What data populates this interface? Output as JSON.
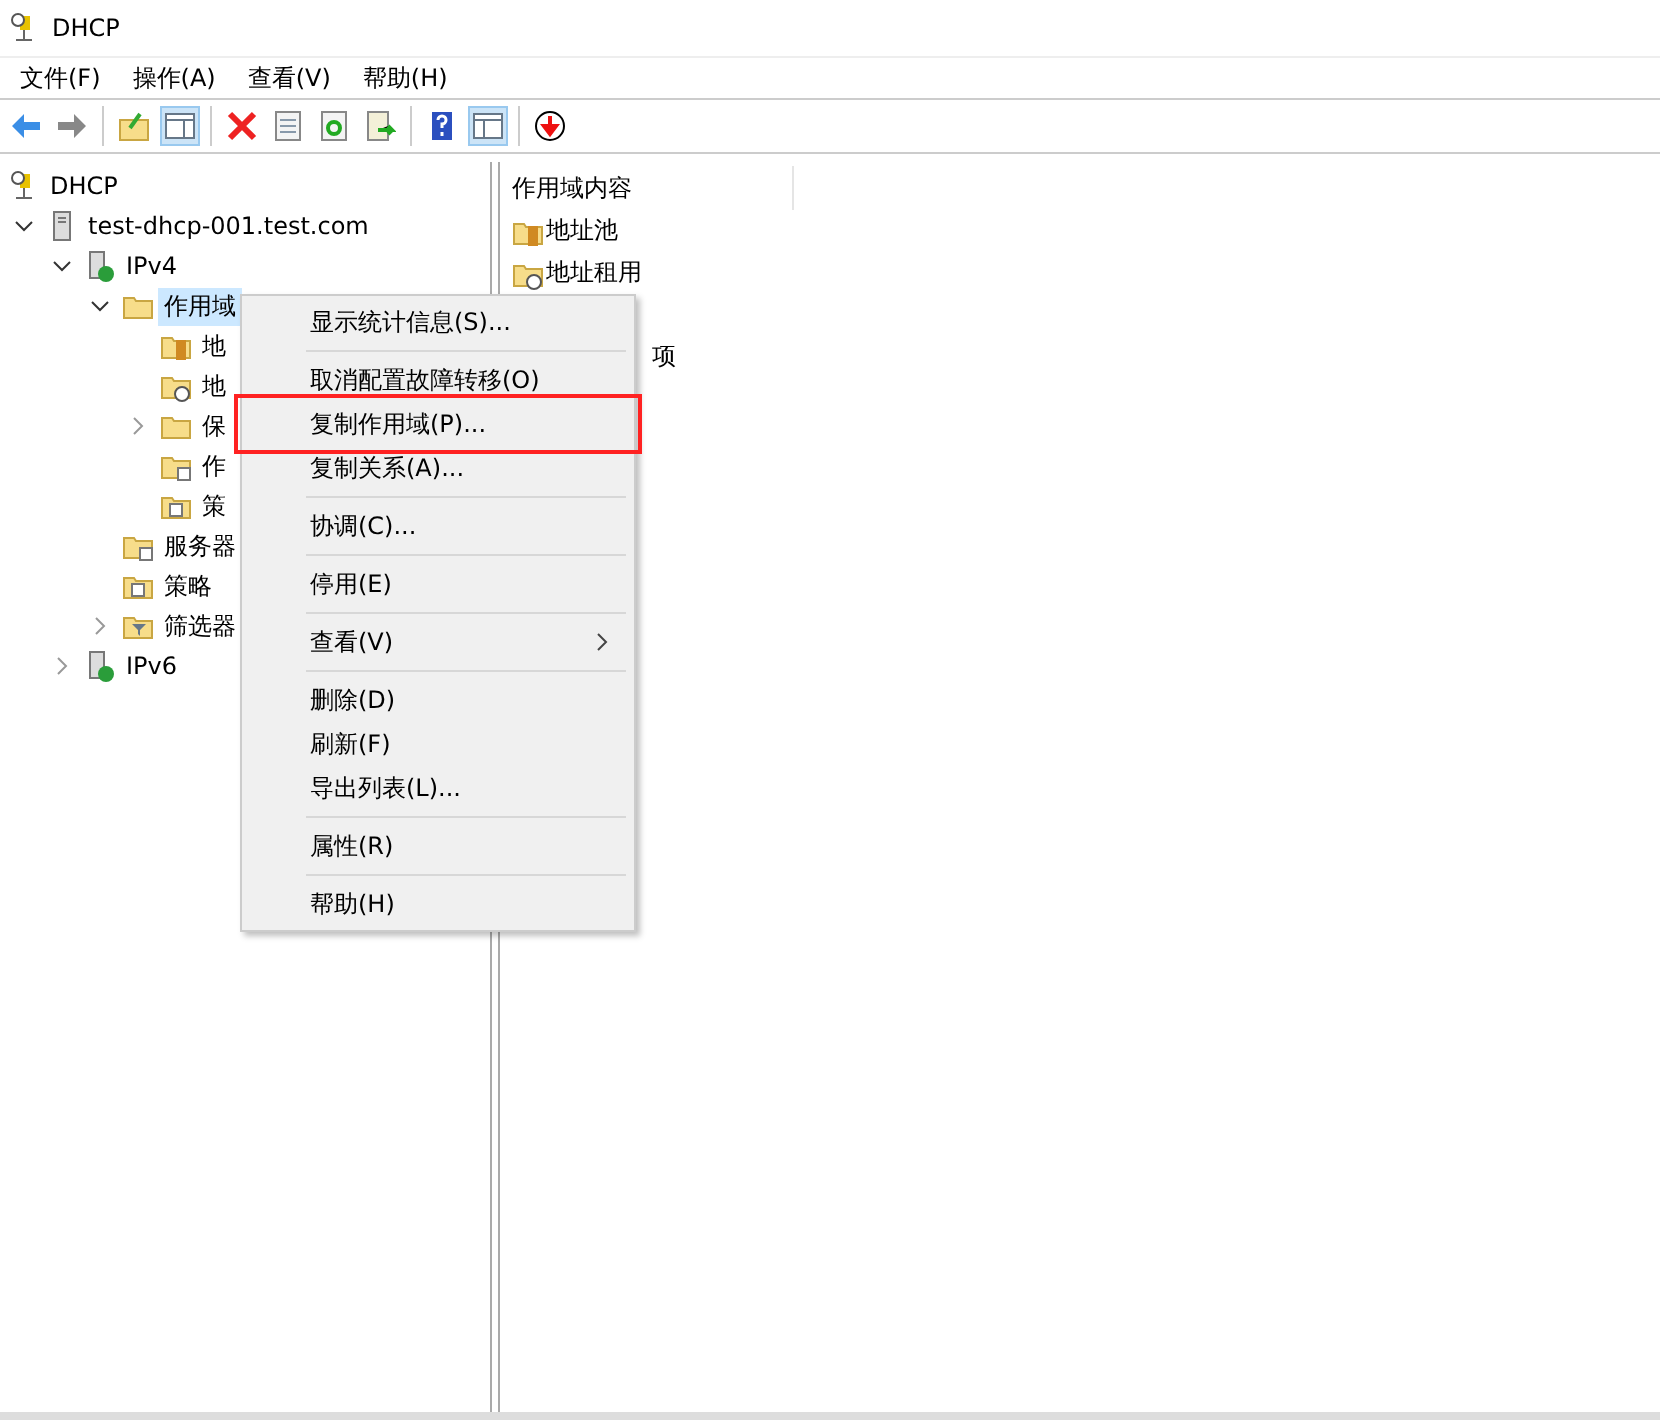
{
  "window": {
    "title": "DHCP"
  },
  "menubar": [
    "文件(F)",
    "操作(A)",
    "查看(V)",
    "帮助(H)"
  ],
  "toolbar": [
    {
      "kind": "back"
    },
    {
      "kind": "forward"
    },
    {
      "kind": "sep"
    },
    {
      "kind": "up"
    },
    {
      "kind": "pane",
      "selected": true
    },
    {
      "kind": "sep"
    },
    {
      "kind": "delete"
    },
    {
      "kind": "props"
    },
    {
      "kind": "refresh"
    },
    {
      "kind": "export"
    },
    {
      "kind": "sep"
    },
    {
      "kind": "help"
    },
    {
      "kind": "action",
      "selected": true
    },
    {
      "kind": "sep"
    },
    {
      "kind": "download"
    }
  ],
  "tree": [
    {
      "label": "DHCP",
      "kind": "root",
      "children": [
        {
          "label": "test-dhcp-001.test.com",
          "kind": "server",
          "expanded": true,
          "children": [
            {
              "label": "IPv4",
              "kind": "ip",
              "expanded": true,
              "children": [
                {
                  "label": "作用域",
                  "kind": "folder",
                  "expanded": true,
                  "selected": true,
                  "children": [
                    {
                      "label": "地",
                      "kind": "pool"
                    },
                    {
                      "label": "地",
                      "kind": "lease"
                    },
                    {
                      "label": "保",
                      "kind": "folder",
                      "expanded": false
                    },
                    {
                      "label": "作",
                      "kind": "options"
                    },
                    {
                      "label": "策",
                      "kind": "policy"
                    }
                  ]
                },
                {
                  "label": "服务器",
                  "kind": "options"
                },
                {
                  "label": "策略",
                  "kind": "policy"
                },
                {
                  "label": "筛选器",
                  "kind": "filter",
                  "expanded": false
                }
              ]
            },
            {
              "label": "IPv6",
              "kind": "ip",
              "expanded": false
            }
          ]
        }
      ]
    }
  ],
  "content": {
    "header": "作用域内容",
    "items": [
      {
        "label": "地址池",
        "kind": "pool"
      },
      {
        "label": "地址租用",
        "kind": "lease"
      },
      {
        "label": "项",
        "kind": "partial"
      }
    ]
  },
  "context_menu": [
    [
      {
        "label": "显示统计信息(S)..."
      }
    ],
    [
      {
        "label": "取消配置故障转移(O)"
      },
      {
        "label": "复制作用域(P)...",
        "highlighted": true
      },
      {
        "label": "复制关系(A)..."
      }
    ],
    [
      {
        "label": "协调(C)..."
      }
    ],
    [
      {
        "label": "停用(E)"
      }
    ],
    [
      {
        "label": "查看(V)",
        "submenu": true
      }
    ],
    [
      {
        "label": "删除(D)"
      },
      {
        "label": "刷新(F)"
      },
      {
        "label": "导出列表(L)..."
      }
    ],
    [
      {
        "label": "属性(R)"
      }
    ],
    [
      {
        "label": "帮助(H)"
      }
    ]
  ]
}
